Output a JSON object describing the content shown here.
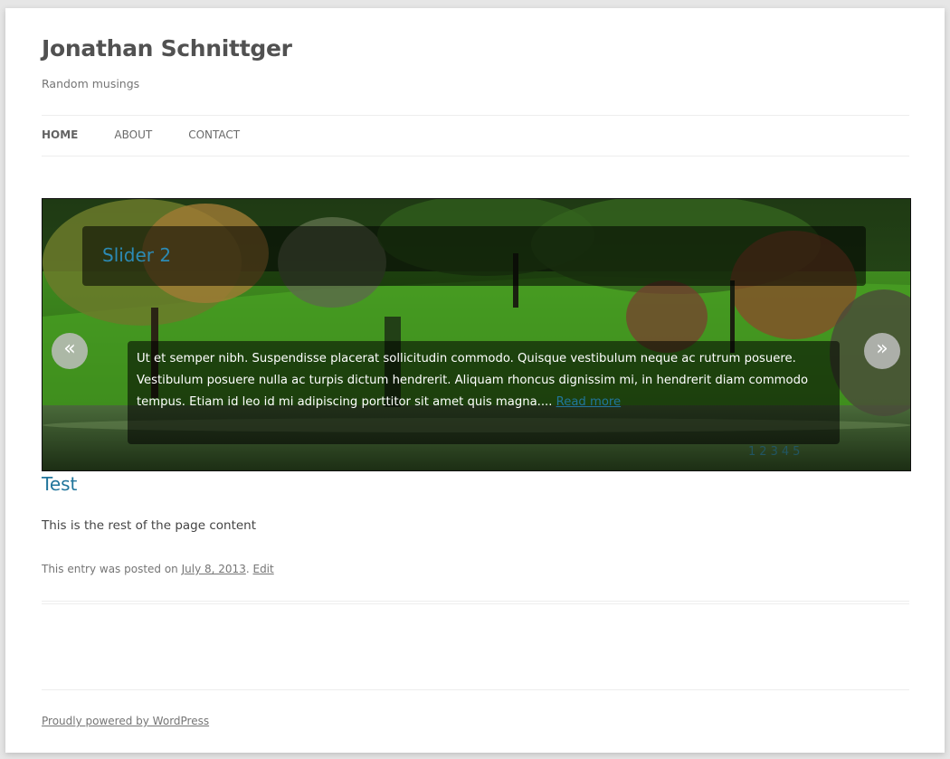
{
  "site": {
    "title": "Jonathan Schnittger",
    "description": "Random musings"
  },
  "nav": {
    "items": [
      {
        "label": "HOME"
      },
      {
        "label": "ABOUT"
      },
      {
        "label": "CONTACT"
      }
    ]
  },
  "slider": {
    "slide_title": "Slider 2",
    "slide_text": "Ut et semper nibh. Suspendisse placerat sollicitudin commodo. Quisque vestibulum neque ac rutrum posuere. Vestibulum posuere nulla ac turpis dictum hendrerit. Aliquam rhoncus dignissim mi, in hendrerit diam commodo tempus. Etiam id leo id mi adipiscing porttitor sit amet quis magna....",
    "read_more": "Read more",
    "prev_label": "«",
    "next_label": "»",
    "pages": [
      "1",
      "2",
      "3",
      "4",
      "5"
    ]
  },
  "post": {
    "title": "Test",
    "content": "This is the rest of the page content",
    "meta_prefix": "This entry was posted on",
    "date": "July 8, 2013",
    "meta_sep": ".",
    "edit_label": "Edit"
  },
  "footer": {
    "credit": "Proudly powered by WordPress"
  },
  "colors": {
    "link": "#21759b",
    "slide_title": "#2c8ab4",
    "text": "#444444"
  }
}
